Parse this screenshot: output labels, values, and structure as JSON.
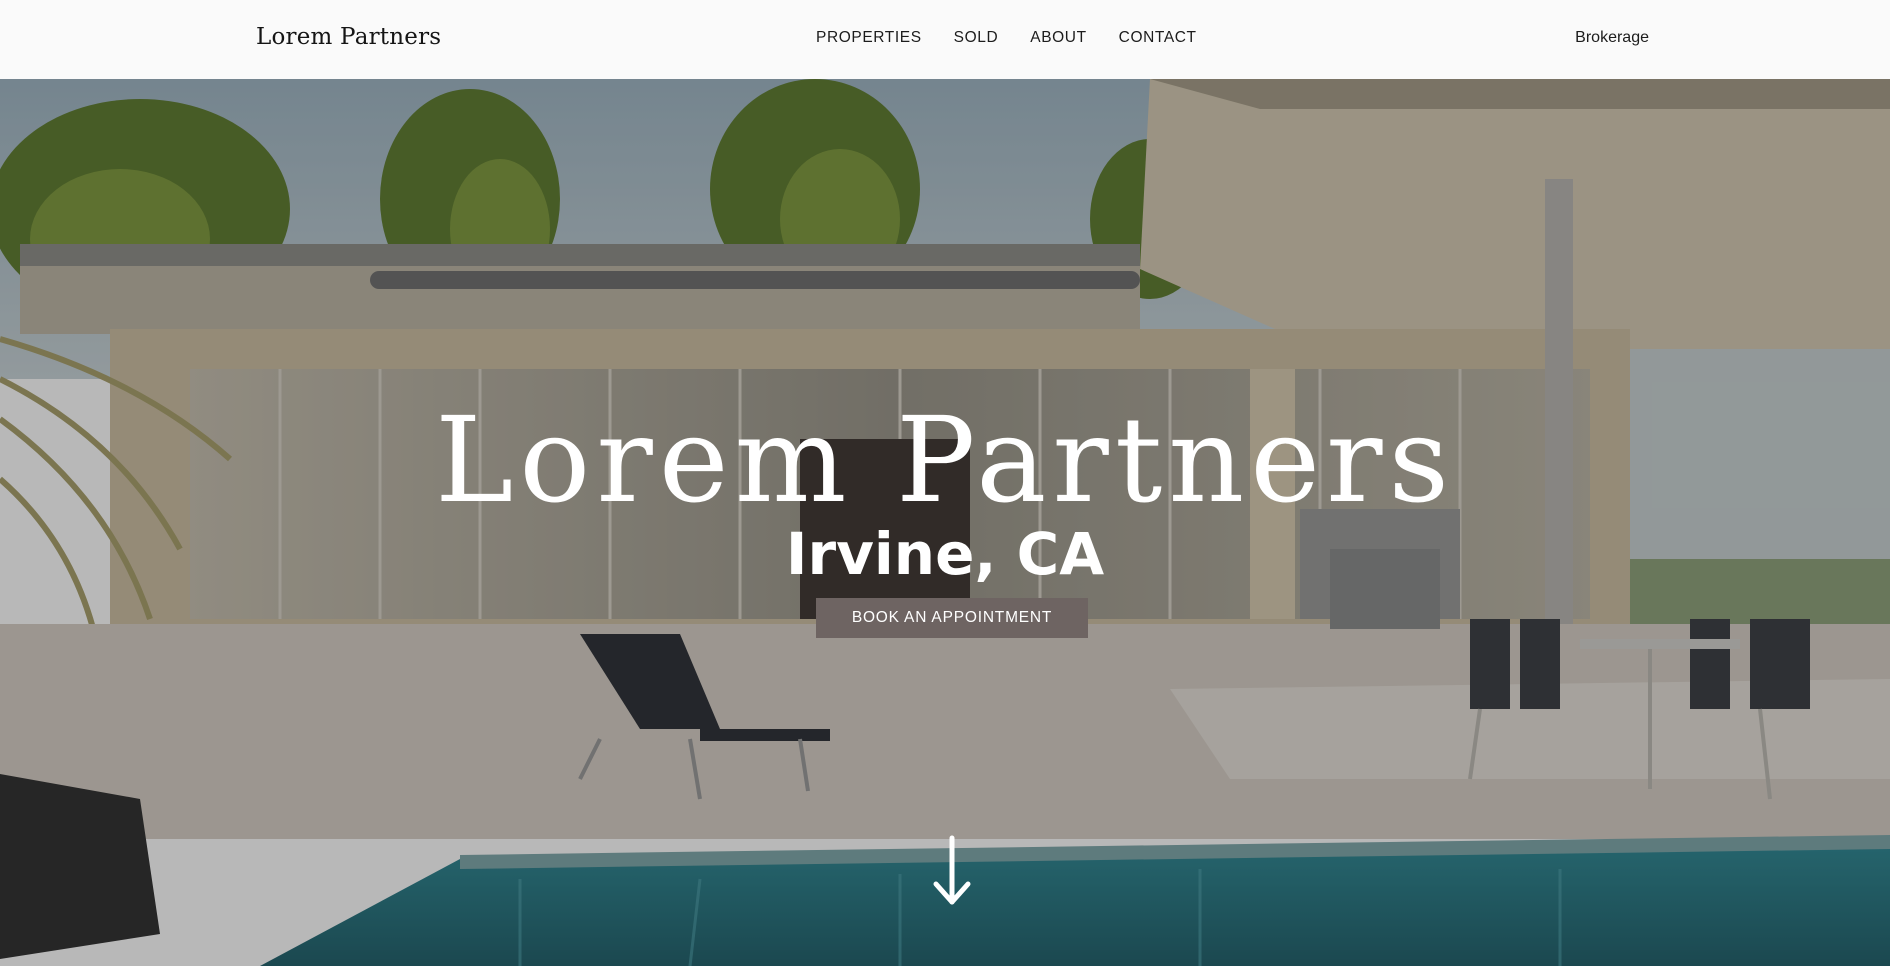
{
  "header": {
    "brand": "Lorem Partners",
    "nav": [
      {
        "label": "PROPERTIES"
      },
      {
        "label": "SOLD"
      },
      {
        "label": "ABOUT"
      },
      {
        "label": "CONTACT"
      }
    ],
    "brokerage": "Brokerage"
  },
  "hero": {
    "title": "Lorem Partners",
    "subtitle": "Irvine, CA",
    "cta": "BOOK AN APPOINTMENT",
    "scroll_icon": "arrow-down-icon",
    "image_description_icon": "modern-house-pool-photo"
  },
  "colors": {
    "header_bg": "#fafafa",
    "text_dark": "#1c1c1c",
    "cta_bg": "#6e6462",
    "hero_text": "#ffffff"
  }
}
